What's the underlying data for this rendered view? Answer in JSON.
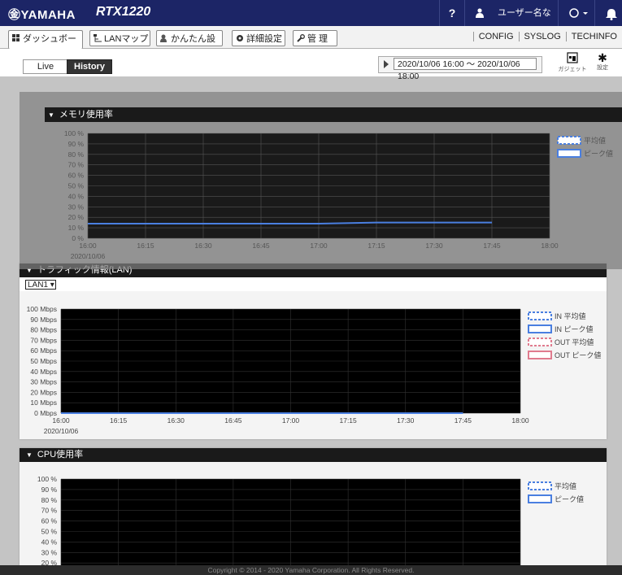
{
  "header": {
    "logo": "㊎YAMAHA",
    "model": "RTX1220",
    "help": "?",
    "user": "ユーザー名なし",
    "circle": "○ ▾"
  },
  "tabs": [
    {
      "label": "ダッシュボード",
      "icon": "dashboard-icon"
    },
    {
      "label": "LANマップ",
      "icon": "lanmap-icon"
    },
    {
      "label": "かんたん設定",
      "icon": "wizard-icon"
    },
    {
      "label": "詳細設定",
      "icon": "gear-icon"
    },
    {
      "label": "管 理",
      "icon": "tools-icon"
    }
  ],
  "links": [
    "CONFIG",
    "SYSLOG",
    "TECHINFO"
  ],
  "view": {
    "live": "Live",
    "history": "History",
    "range": "2020/10/06 16:00 ～ 2020/10/06 18:00",
    "gadget": "ガジェット",
    "settings": "設定"
  },
  "memory": {
    "title": "メモリ使用率",
    "y_ticks": [
      "100 %",
      "90 %",
      "80 %",
      "70 %",
      "60 %",
      "50 %",
      "40 %",
      "30 %",
      "20 %",
      "10 %",
      "0 %"
    ],
    "x_ticks": [
      "16:00",
      "16:15",
      "16:30",
      "16:45",
      "17:00",
      "17:15",
      "17:30",
      "17:45",
      "18:00"
    ],
    "date": "2020/10/06",
    "legend": [
      "平均値",
      "ピーク値"
    ]
  },
  "traffic": {
    "title": "トラフィック情報(LAN)",
    "select": "LAN1",
    "y_ticks": [
      "100 Mbps",
      "90 Mbps",
      "80 Mbps",
      "70 Mbps",
      "60 Mbps",
      "50 Mbps",
      "40 Mbps",
      "30 Mbps",
      "20 Mbps",
      "10 Mbps",
      "0 Mbps"
    ],
    "x_ticks": [
      "16:00",
      "16:15",
      "16:30",
      "16:45",
      "17:00",
      "17:15",
      "17:30",
      "17:45",
      "18:00"
    ],
    "date": "2020/10/06",
    "legend": [
      "IN 平均値",
      "IN ピーク値",
      "OUT 平均値",
      "OUT ピーク値"
    ]
  },
  "cpu": {
    "title": "CPU使用率",
    "y_ticks": [
      "100 %",
      "90 %",
      "80 %",
      "70 %",
      "60 %",
      "50 %",
      "40 %",
      "30 %",
      "20 %"
    ],
    "legend": [
      "平均値",
      "ピーク値"
    ]
  },
  "footer": "Copyright © 2014 - 2020 Yamaha Corporation. All Rights Reserved.",
  "colors": {
    "header": "#1c2566",
    "line": "#4a7fe0",
    "out": "#e07b8e"
  },
  "chart_data": [
    {
      "type": "line",
      "title": "メモリ使用率",
      "ylabel": "%",
      "ylim": [
        0,
        100
      ],
      "x": [
        "16:00",
        "16:15",
        "16:30",
        "16:45",
        "17:00",
        "17:15",
        "17:30",
        "17:45",
        "18:00"
      ],
      "series": [
        {
          "name": "平均値",
          "values": [
            14,
            14,
            14,
            14,
            14,
            15,
            15,
            15,
            null
          ]
        },
        {
          "name": "ピーク値",
          "values": [
            14,
            14,
            14,
            14,
            14,
            15,
            15,
            15,
            null
          ]
        }
      ]
    },
    {
      "type": "line",
      "title": "トラフィック情報(LAN)",
      "ylim": [
        0,
        100
      ],
      "x": [
        "16:00",
        "16:15",
        "16:30",
        "16:45",
        "17:00",
        "17:15",
        "17:30",
        "17:45",
        "18:00"
      ],
      "series": [
        {
          "name": "IN 平均値",
          "values": [
            0,
            0,
            0,
            0,
            0,
            0,
            0,
            0,
            null
          ]
        },
        {
          "name": "IN ピーク値",
          "values": [
            0,
            0,
            0,
            0,
            0,
            0,
            0,
            0,
            null
          ]
        },
        {
          "name": "OUT 平均値",
          "values": [
            0,
            0,
            0,
            0,
            0,
            0,
            0,
            0,
            null
          ]
        },
        {
          "name": "OUT ピーク値",
          "values": [
            0,
            0,
            0,
            0,
            0,
            0,
            0,
            0,
            null
          ]
        }
      ]
    },
    {
      "type": "line",
      "title": "CPU使用率",
      "ylabel": "%",
      "ylim": [
        0,
        100
      ],
      "x": [],
      "series": []
    }
  ]
}
